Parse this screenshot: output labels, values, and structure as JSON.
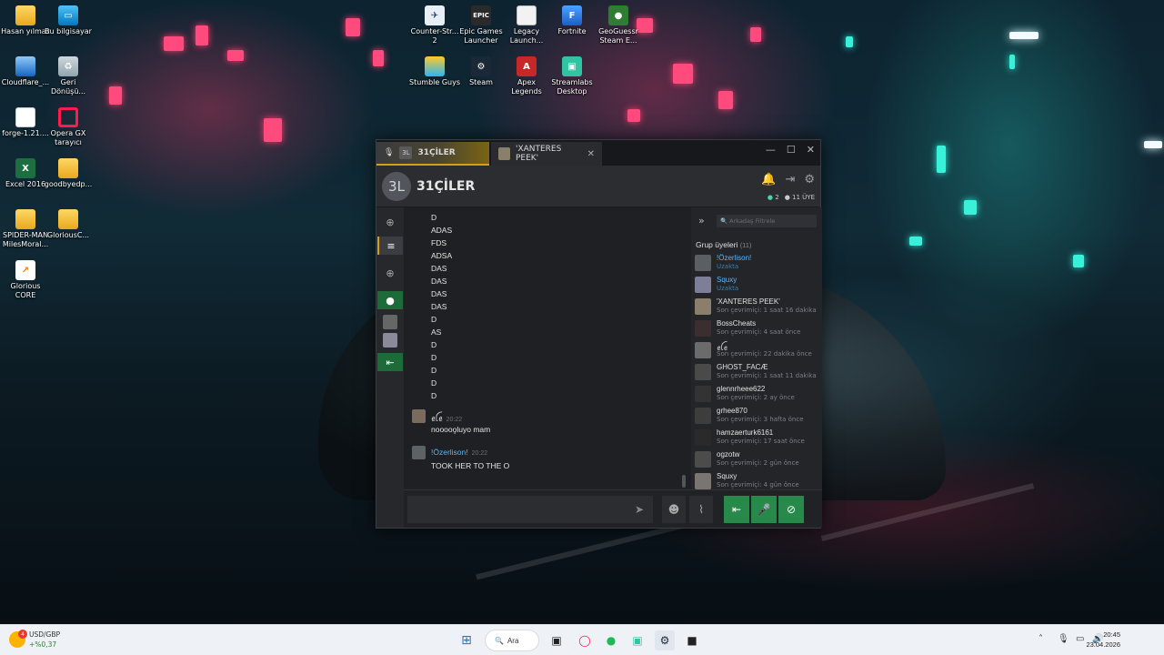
{
  "desktop_icons": [
    {
      "label": "Hasan yılmaz",
      "icon": "folder-icon"
    },
    {
      "label": "Bu bilgisayar",
      "icon": "computer-icon"
    },
    {
      "label": "Cloudflare_...",
      "icon": "cloudflare-icon"
    },
    {
      "label": "Geri Dönüşü...",
      "icon": "recycle-bin-icon"
    },
    {
      "label": "forge-1.21....",
      "icon": "document-icon"
    },
    {
      "label": "Opera GX tarayıcı",
      "icon": "opera-gx-icon"
    },
    {
      "label": "Excel 2016",
      "icon": "excel-icon"
    },
    {
      "label": "goodbyedp...",
      "icon": "folder-icon"
    },
    {
      "label": "SPIDER-MAN MilesMoral...",
      "icon": "folder-icon"
    },
    {
      "label": "GloriousC...",
      "icon": "folder-icon"
    },
    {
      "label": "Glorious CORE",
      "icon": "glorious-core-icon"
    },
    {
      "label": "Counter-Str... 2",
      "icon": "counter-strike-icon"
    },
    {
      "label": "Epic Games Launcher",
      "icon": "epic-games-icon"
    },
    {
      "label": "Legacy Launch...",
      "icon": "legacy-launcher-icon"
    },
    {
      "label": "Fortnite",
      "icon": "fortnite-icon"
    },
    {
      "label": "GeoGuessr Steam E...",
      "icon": "geoguessr-icon"
    },
    {
      "label": "Stumble Guys",
      "icon": "stumble-guys-icon"
    },
    {
      "label": "Steam",
      "icon": "steam-icon"
    },
    {
      "label": "Apex Legends",
      "icon": "apex-legends-icon"
    },
    {
      "label": "Streamlabs Desktop",
      "icon": "streamlabs-icon"
    }
  ],
  "chat_window": {
    "tabs": [
      {
        "mini": "3L",
        "label": "31ÇİLER",
        "active": true
      },
      {
        "label": "'XANTERES PEEK'",
        "active": false
      }
    ],
    "window_controls": {
      "minimize": "—",
      "maximize": "☐",
      "close": "✕"
    },
    "group": {
      "avatar_text": "3L",
      "name": "31ÇİLER",
      "online_count": "2",
      "member_count": "11 ÜYE"
    },
    "messages": {
      "plain_lines": [
        "D",
        "ADAS",
        "FDS",
        "ADSA",
        "DAS",
        "DAS",
        "DAS",
        "DAS",
        "D",
        "AS",
        "D",
        "D",
        "D",
        "D",
        "D"
      ],
      "blocks": [
        {
          "author": "ꫀꪶꫀ",
          "time": "20:22",
          "text": "nooooo̧luyo mam",
          "author_style": "normal"
        },
        {
          "author": "!Özerlison!",
          "time": "20:22",
          "text": "TOOK HER TO THE O",
          "author_style": "blue"
        }
      ]
    },
    "members_panel": {
      "search_placeholder": "Arkadaş Filtrele",
      "header": "Grup üyeleri",
      "header_count": "(11)",
      "members": [
        {
          "name": "!Özerlison!",
          "status": "Uzakta",
          "style": "blue",
          "away": true
        },
        {
          "name": "Squxy",
          "status": "Uzakta",
          "style": "blue",
          "away": true
        },
        {
          "name": "'XANTERES PEEK'",
          "status": "Son çevrimiçi: 1 saat 16 dakika",
          "style": "normal",
          "away": false
        },
        {
          "name": "BossCheats",
          "status": "Son çevrimiçi: 4 saat önce",
          "style": "normal",
          "away": false
        },
        {
          "name": "ꫀꪶꫀ",
          "status": "Son çevrimiçi: 22 dakika önce",
          "style": "normal",
          "away": false
        },
        {
          "name": "GHOST_FACÆ",
          "status": "Son çevrimiçi: 1 saat 11 dakika",
          "style": "normal",
          "away": false
        },
        {
          "name": "glennrheee622",
          "status": "Son çevrimiçi: 2 ay önce",
          "style": "normal",
          "away": false
        },
        {
          "name": "grhee870",
          "status": "Son çevrimiçi: 3 hafta önce",
          "style": "normal",
          "away": false
        },
        {
          "name": "hamzaerturk6161",
          "status": "Son çevrimiçi: 17 saat önce",
          "style": "normal",
          "away": false
        },
        {
          "name": "ogzotw",
          "status": "Son çevrimiçi: 2 gün önce",
          "style": "normal",
          "away": false
        },
        {
          "name": "Squxy",
          "status": "Son çevrimiçi: 4 gün önce",
          "style": "normal",
          "away": false
        }
      ]
    }
  },
  "taskbar": {
    "ticker_pair": "USD/GBP",
    "ticker_change": "+%0,37",
    "ticker_badge": "4",
    "search_label": "Ara",
    "time": "20:45",
    "date": "23.04.2026"
  },
  "colors": {
    "accent_gold": "#d4a017",
    "voice_green": "#27894a",
    "member_blue": "#56b6ff"
  }
}
